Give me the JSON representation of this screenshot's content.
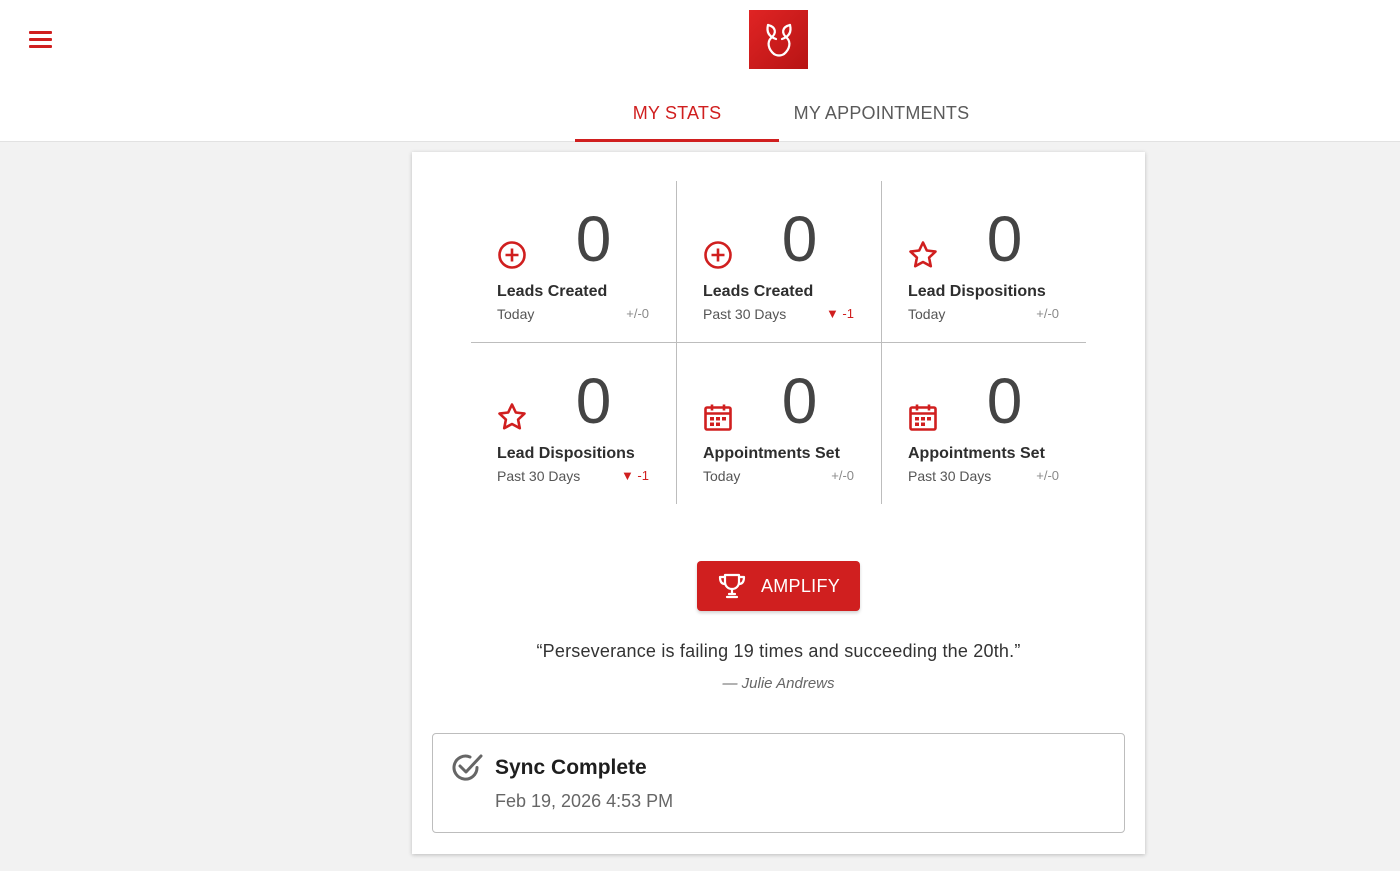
{
  "colors": {
    "accent": "#d01f1f",
    "background": "#f2f2f2",
    "card": "#ffffff"
  },
  "header": {
    "menu_icon": "hamburger-menu-icon",
    "logo_icon": "brand-logo-icon"
  },
  "tabs": [
    {
      "label": "MY STATS",
      "active": true
    },
    {
      "label": "MY APPOINTMENTS",
      "active": false
    }
  ],
  "stats": [
    {
      "icon": "plus-circle-icon",
      "value": "0",
      "title": "Leads Created",
      "period": "Today",
      "delta": "+/-0",
      "trend": "neutral"
    },
    {
      "icon": "plus-circle-icon",
      "value": "0",
      "title": "Leads Created",
      "period": "Past 30 Days",
      "delta": "▼ -1",
      "trend": "down"
    },
    {
      "icon": "star-icon",
      "value": "0",
      "title": "Lead Dispositions",
      "period": "Today",
      "delta": "+/-0",
      "trend": "neutral"
    },
    {
      "icon": "star-icon",
      "value": "0",
      "title": "Lead Dispositions",
      "period": "Past 30 Days",
      "delta": "▼ -1",
      "trend": "down"
    },
    {
      "icon": "calendar-icon",
      "value": "0",
      "title": "Appointments Set",
      "period": "Today",
      "delta": "+/-0",
      "trend": "neutral"
    },
    {
      "icon": "calendar-icon",
      "value": "0",
      "title": "Appointments Set",
      "period": "Past 30 Days",
      "delta": "+/-0",
      "trend": "neutral"
    }
  ],
  "amplify": {
    "label": "AMPLIFY",
    "icon": "trophy-icon"
  },
  "quote": {
    "text": "“Perseverance is failing 19 times and succeeding the 20th.”",
    "author": "— Julie Andrews"
  },
  "sync": {
    "icon": "check-circle-icon",
    "title": "Sync Complete",
    "timestamp": "Feb 19, 2026 4:53 PM"
  }
}
